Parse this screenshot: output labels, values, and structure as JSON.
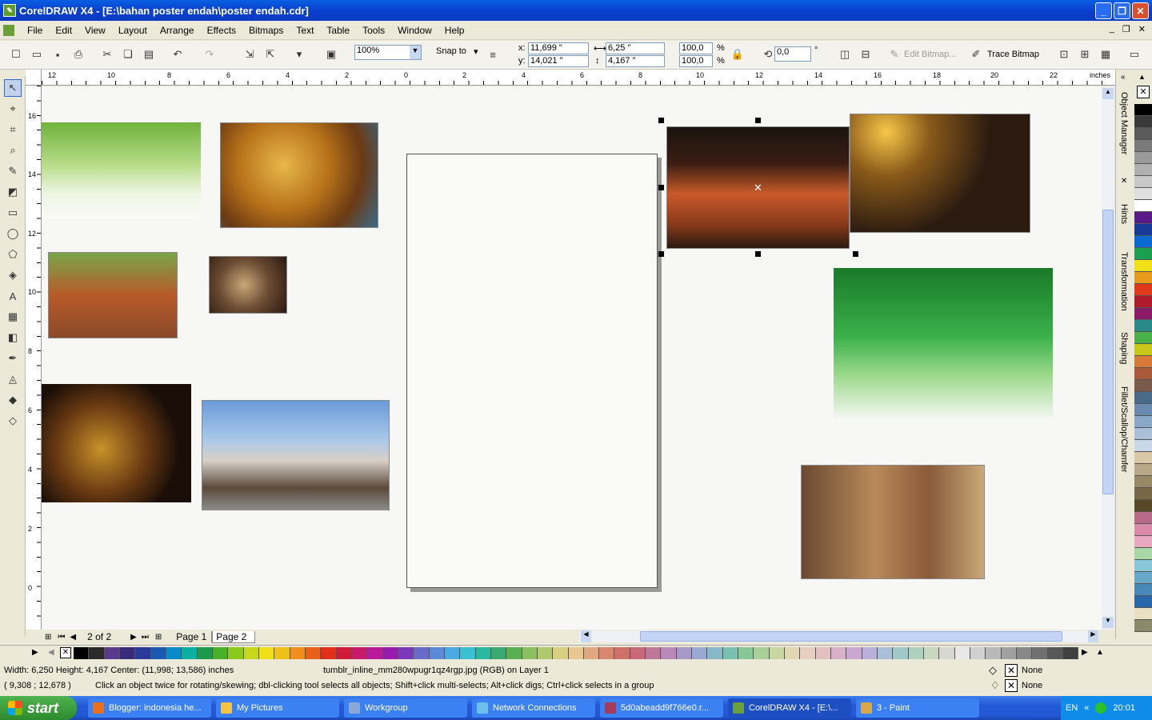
{
  "window": {
    "title": "CorelDRAW X4 - [E:\\bahan poster endah\\poster endah.cdr]"
  },
  "menu": [
    "File",
    "Edit",
    "View",
    "Layout",
    "Arrange",
    "Effects",
    "Bitmaps",
    "Text",
    "Table",
    "Tools",
    "Window",
    "Help"
  ],
  "toolbar": {
    "zoom": "100%",
    "snap_to": "Snap to",
    "x_label": "x:",
    "y_label": "y:",
    "x_value": "11,699 \"",
    "y_value": "14,021 \"",
    "w_value": "6,25 \"",
    "h_value": "4,167 \"",
    "scale_w": "100,0",
    "scale_h": "100,0",
    "pct": "%",
    "rotation": "0,0",
    "degree": "°",
    "edit_bitmap": "Edit Bitmap...",
    "trace_bitmap": "Trace Bitmap"
  },
  "ruler": {
    "h_ticks": [
      "12",
      "10",
      "8",
      "6",
      "4",
      "2",
      "0",
      "2",
      "4",
      "6",
      "8",
      "10",
      "12",
      "14",
      "16",
      "18",
      "20",
      "22"
    ],
    "v_ticks": [
      "16",
      "14",
      "12",
      "10",
      "8",
      "6",
      "4",
      "2",
      "0"
    ],
    "unit": "inches"
  },
  "docker_tabs": [
    "Object Manager",
    "Hints",
    "Transformation",
    "Shaping",
    "Fillet/Scallop/Chamfer"
  ],
  "pagebar": {
    "counter": "2 of 2",
    "pages": [
      "Page 1",
      "Page 2"
    ],
    "active": "Page 2"
  },
  "status": {
    "dims": "Width: 6,250  Height: 4,167  Center: (11,998; 13,586)  inches",
    "object": "tumblr_inline_mm280wpugr1qz4rgp.jpg (RGB) on Layer 1",
    "coords": "( 9,308 ; 12,678 )",
    "hint": "Click an object twice for rotating/skewing; dbl-clicking tool selects all objects; Shift+click multi-selects; Alt+click digs; Ctrl+click selects in a group",
    "fill": "None",
    "outline": "None"
  },
  "taskbar": {
    "start": "start",
    "tasks": [
      "Blogger: indonesia he...",
      "My Pictures",
      "Workgroup",
      "Network Connections",
      "5d0abeadd9f766e0.r...",
      "CorelDRAW X4 - [E:\\...",
      "3 - Paint"
    ],
    "active_task": 5,
    "lang": "EN",
    "clock": "20:01"
  },
  "palette": [
    "#000000",
    "#2b2b2b",
    "#5a3a8a",
    "#3a2a7a",
    "#2a3a9a",
    "#1a5ab0",
    "#0a8ac8",
    "#0ab0a0",
    "#1a9a4a",
    "#4ab02a",
    "#8ac81a",
    "#c8d81a",
    "#f0e01a",
    "#f0c01a",
    "#f0901a",
    "#e8601a",
    "#e0301a",
    "#d01a3a",
    "#c81a6a",
    "#b81a9a",
    "#9a1ab0",
    "#7a3ab8",
    "#6a6ac8",
    "#5a8ad8",
    "#4aaae0",
    "#3ac0d0",
    "#2ab8a0",
    "#3aa870",
    "#5ab050",
    "#8ac060",
    "#b0c870",
    "#d8d080",
    "#e8c890",
    "#e0a880",
    "#d88870",
    "#d07068",
    "#c86878",
    "#c07898",
    "#b888b8",
    "#a898c8",
    "#98a8d0",
    "#88b8c8",
    "#78c0b0",
    "#88c898",
    "#a8d098",
    "#c8d8a0",
    "#e0d8b0",
    "#e8d0c0",
    "#e0c0c0",
    "#d8b0c8",
    "#c8a8d0",
    "#b8b0d8",
    "#a8c0d8",
    "#a0c8c8",
    "#b0d0c0",
    "#c8d8c0",
    "#d8d8d0",
    "#e8e8e8",
    "#d0d0d0",
    "#b8b8b8",
    "#a0a0a0",
    "#888888",
    "#707070",
    "#585858",
    "#404040"
  ],
  "palette_v": [
    "#000000",
    "#3a3a3a",
    "#5a5a5a",
    "#7a7a7a",
    "#9a9a9a",
    "#b0b0b0",
    "#c8c8c8",
    "#e0e0e0",
    "#ffffff",
    "#5a1a8a",
    "#1a3a9a",
    "#0a6ad0",
    "#1aa050",
    "#f0e01a",
    "#e89a1a",
    "#e03a1a",
    "#b01a2a",
    "#8a1a6a",
    "#2a8a8a",
    "#4ab04a",
    "#c8c81a",
    "#d87a3a",
    "#a85a3a",
    "#7a5a4a",
    "#4a6a8a",
    "#6a8ab0",
    "#8aa8c8",
    "#aac0d8",
    "#c8d8e8",
    "#d8c8a8",
    "#b8a888",
    "#988868",
    "#786848",
    "#584828",
    "#b86a8a",
    "#d88aa8",
    "#e8a8c0",
    "#a8d8a8",
    "#88c8d8",
    "#68a8c8",
    "#4888b8",
    "#2868a8",
    "#e8e0c0",
    "#8a8a6a"
  ]
}
